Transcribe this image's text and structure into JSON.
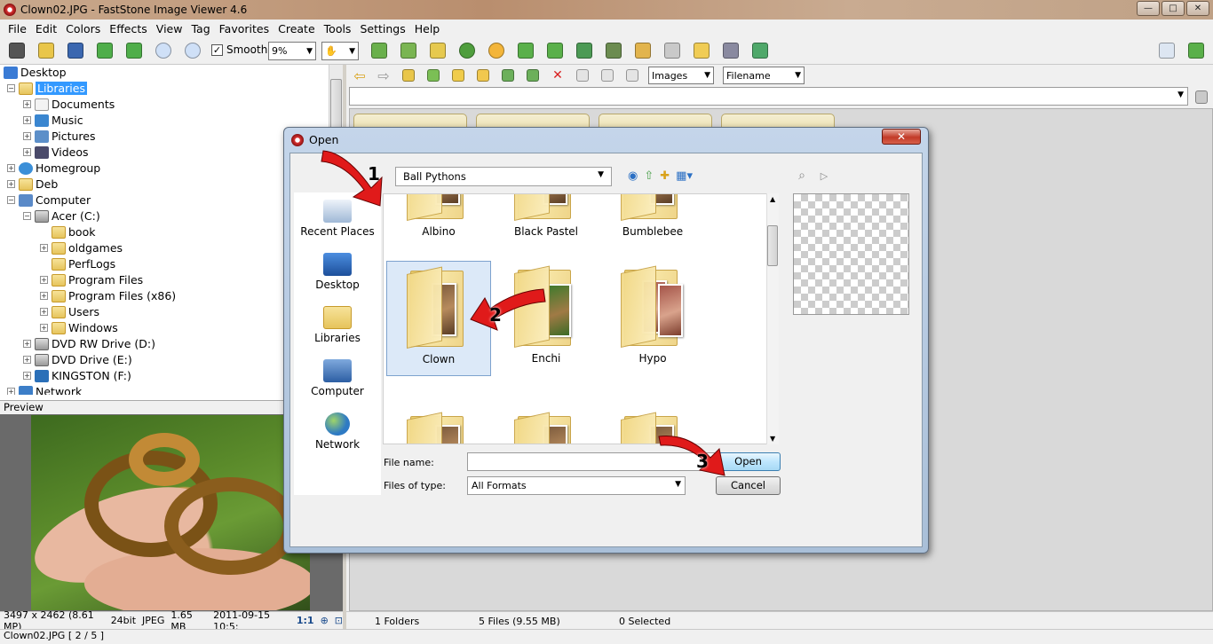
{
  "window": {
    "title": "Clown02.JPG  -  FastStone Image Viewer 4.6",
    "min": "—",
    "max": "□",
    "close": "✕"
  },
  "menu": [
    "File",
    "Edit",
    "Colors",
    "Effects",
    "View",
    "Tag",
    "Favorites",
    "Create",
    "Tools",
    "Settings",
    "Help"
  ],
  "toolbar": {
    "smooth_label": "Smooth",
    "smooth_checked": "✓",
    "zoom_value": "9%"
  },
  "tree": [
    {
      "label": "Desktop"
    },
    {
      "label": "Libraries"
    },
    {
      "label": "Documents"
    },
    {
      "label": "Music"
    },
    {
      "label": "Pictures"
    },
    {
      "label": "Videos"
    },
    {
      "label": "Homegroup"
    },
    {
      "label": "Deb"
    },
    {
      "label": "Computer"
    },
    {
      "label": "Acer (C:)"
    },
    {
      "label": "book"
    },
    {
      "label": "oldgames"
    },
    {
      "label": "PerfLogs"
    },
    {
      "label": "Program Files"
    },
    {
      "label": "Program Files (x86)"
    },
    {
      "label": "Users"
    },
    {
      "label": "Windows"
    },
    {
      "label": "DVD RW Drive (D:)"
    },
    {
      "label": "DVD Drive (E:)"
    },
    {
      "label": "KINGSTON (F:)"
    },
    {
      "label": "Network"
    }
  ],
  "preview_header": "Preview",
  "status_left": {
    "dims": "3497 x 2462 (8.61 MP)",
    "depth": "24bit",
    "format": "JPEG",
    "size": "1.65 MB",
    "date": "2011-09-15 10:5:",
    "ratio": "1:1"
  },
  "status_bottom": "Clown02.JPG [ 2 / 5 ]",
  "browse": {
    "filter": "Images",
    "sort": "Filename"
  },
  "main_status": {
    "folders": "1 Folders",
    "files": "5 Files (9.55 MB)",
    "selected": "0 Selected"
  },
  "dialog": {
    "title": "Open",
    "close": "✕",
    "look_in": "Ball Pythons",
    "places": [
      "Recent Places",
      "Desktop",
      "Libraries",
      "Computer",
      "Network"
    ],
    "folders": [
      "Albino",
      "Black Pastel",
      "Bumblebee",
      "Clown",
      "Enchi",
      "Hypo"
    ],
    "file_name_label": "File name:",
    "file_name_value": "",
    "files_of_type_label": "Files of type:",
    "files_of_type_value": "All Formats",
    "open_label": "Open",
    "cancel_label": "Cancel"
  },
  "annotations": [
    "1",
    "2",
    "3"
  ],
  "colors": {
    "selection": "#3399ff",
    "arrow": "#e01a1a",
    "dialog_frame": "#a9bfd8"
  }
}
